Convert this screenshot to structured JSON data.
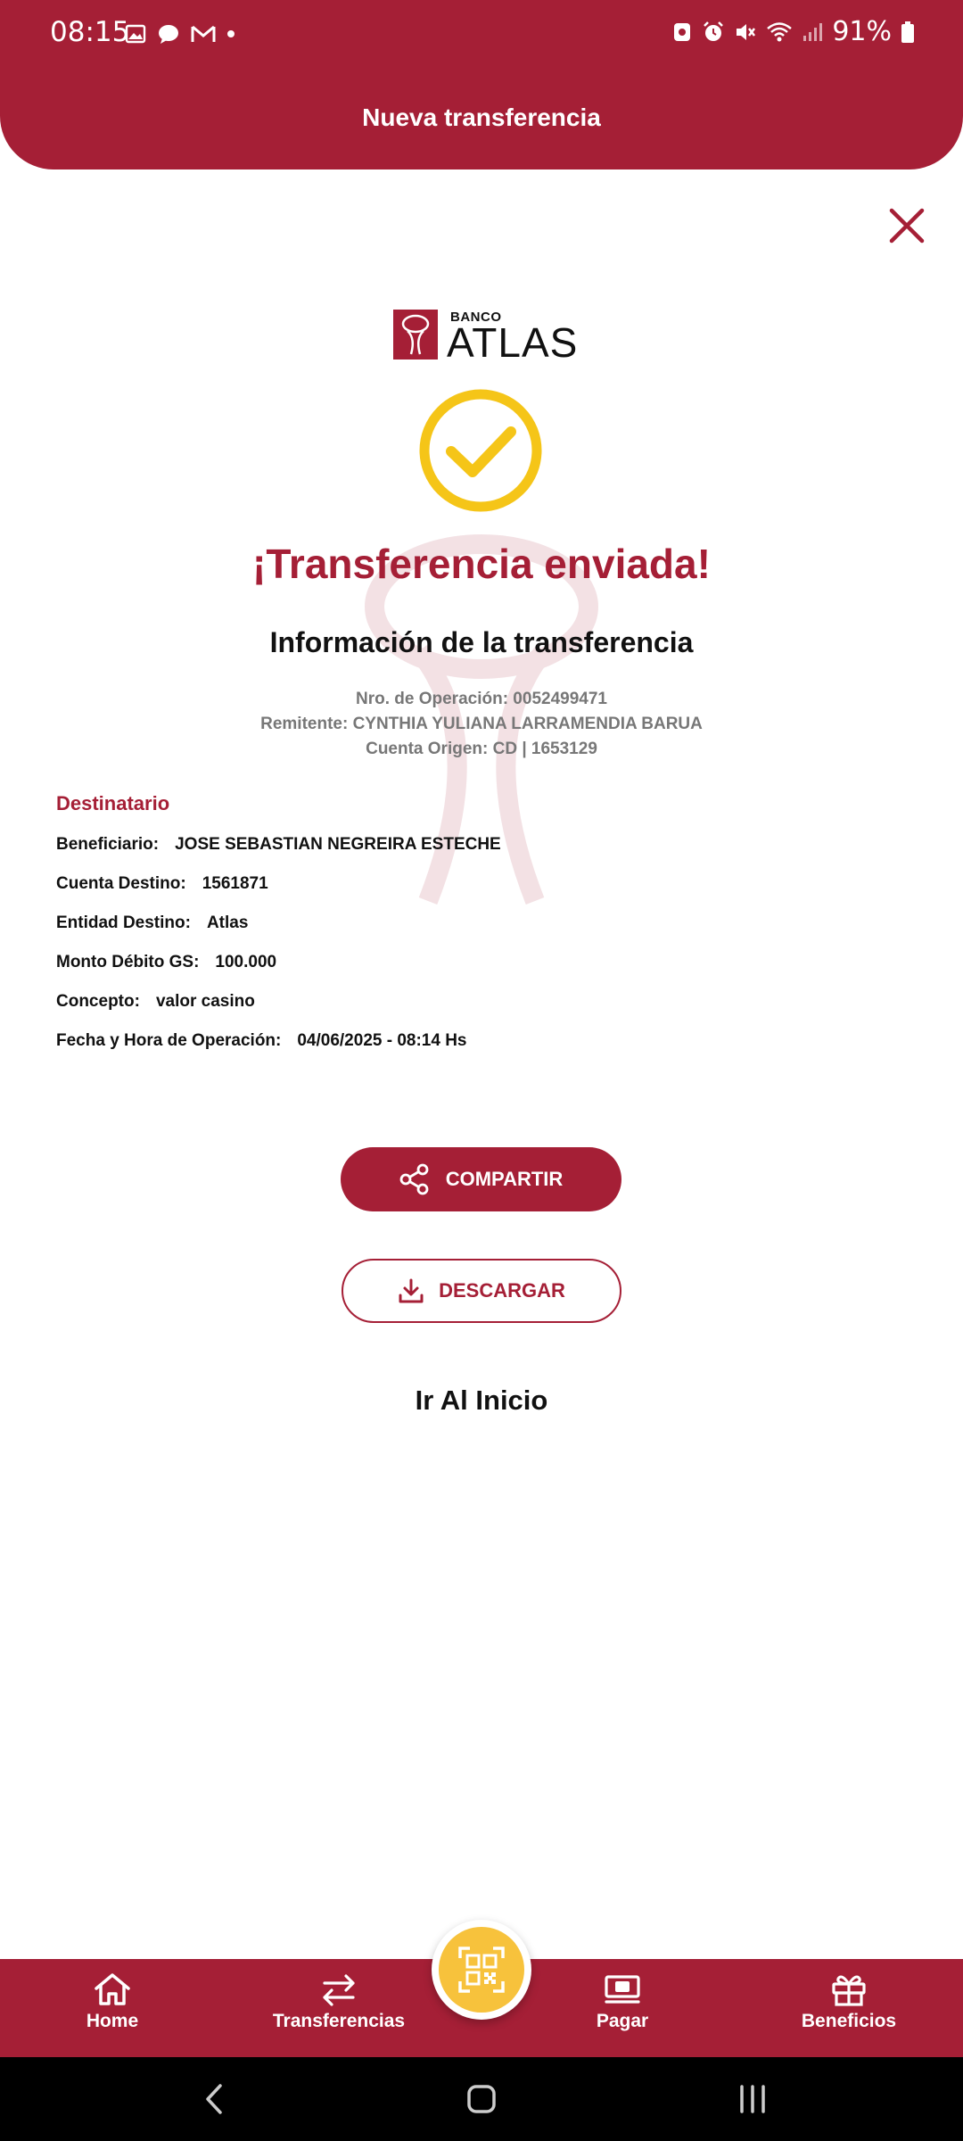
{
  "status_bar": {
    "time": "08:15",
    "battery": "91%"
  },
  "header": {
    "title": "Nueva transferencia"
  },
  "logo": {
    "banco": "BANCO",
    "atlas": "ATLAS"
  },
  "result": {
    "title": "¡Transferencia enviada!",
    "info_title": "Información de la transferencia",
    "operation_number": "Nro. de Operación: 0052499471",
    "sender": "Remitente: CYNTHIA YULIANA LARRAMENDIA BARUA",
    "origin_account": "Cuenta Origen: CD | 1653129"
  },
  "recipient": {
    "heading": "Destinatario",
    "rows": [
      {
        "label": "Beneficiario:",
        "value": "JOSE SEBASTIAN NEGREIRA ESTECHE"
      },
      {
        "label": "Cuenta Destino:",
        "value": "1561871"
      },
      {
        "label": "Entidad Destino:",
        "value": "Atlas"
      },
      {
        "label": "Monto Débito GS:",
        "value": "100.000"
      },
      {
        "label": "Concepto:",
        "value": "valor casino"
      },
      {
        "label": "Fecha y Hora de Operación:",
        "value": "04/06/2025 - 08:14 Hs"
      }
    ]
  },
  "actions": {
    "share": "COMPARTIR",
    "download": "DESCARGAR",
    "go_home": "Ir Al Inicio"
  },
  "bottom_nav": {
    "items": [
      {
        "label": "Home",
        "icon": "home-icon"
      },
      {
        "label": "Transferencias",
        "icon": "transfer-arrows-icon"
      },
      {
        "label": "Pagar",
        "icon": "money-icon"
      },
      {
        "label": "Beneficios",
        "icon": "gift-icon"
      }
    ],
    "fab_icon": "qr-scan-icon"
  },
  "colors": {
    "brand": "#a51f36",
    "accent": "#f7c23c",
    "check": "#f5c518"
  }
}
